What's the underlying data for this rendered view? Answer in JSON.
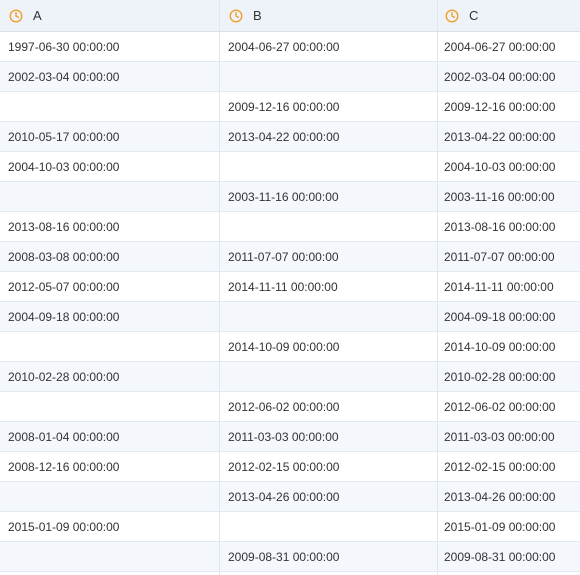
{
  "columns": [
    {
      "label": "A",
      "icon": "clock-icon",
      "icon_color": "#f0a030"
    },
    {
      "label": "B",
      "icon": "clock-icon",
      "icon_color": "#f0a030"
    },
    {
      "label": "C",
      "icon": "clock-icon",
      "icon_color": "#f0a030"
    }
  ],
  "rows": [
    [
      "1997-06-30 00:00:00",
      "2004-06-27 00:00:00",
      "2004-06-27 00:00:00"
    ],
    [
      "2002-03-04 00:00:00",
      "",
      "2002-03-04 00:00:00"
    ],
    [
      "",
      "2009-12-16 00:00:00",
      "2009-12-16 00:00:00"
    ],
    [
      "2010-05-17 00:00:00",
      "2013-04-22 00:00:00",
      "2013-04-22 00:00:00"
    ],
    [
      "2004-10-03 00:00:00",
      "",
      "2004-10-03 00:00:00"
    ],
    [
      "",
      "2003-11-16 00:00:00",
      "2003-11-16 00:00:00"
    ],
    [
      "2013-08-16 00:00:00",
      "",
      "2013-08-16 00:00:00"
    ],
    [
      "2008-03-08 00:00:00",
      "2011-07-07 00:00:00",
      "2011-07-07 00:00:00"
    ],
    [
      "2012-05-07 00:00:00",
      "2014-11-11 00:00:00",
      "2014-11-11 00:00:00"
    ],
    [
      "2004-09-18 00:00:00",
      "",
      "2004-09-18 00:00:00"
    ],
    [
      "",
      "2014-10-09 00:00:00",
      "2014-10-09 00:00:00"
    ],
    [
      "2010-02-28 00:00:00",
      "",
      "2010-02-28 00:00:00"
    ],
    [
      "",
      "2012-06-02 00:00:00",
      "2012-06-02 00:00:00"
    ],
    [
      "2008-01-04 00:00:00",
      "2011-03-03 00:00:00",
      "2011-03-03 00:00:00"
    ],
    [
      "2008-12-16 00:00:00",
      "2012-02-15 00:00:00",
      "2012-02-15 00:00:00"
    ],
    [
      "",
      "2013-04-26 00:00:00",
      "2013-04-26 00:00:00"
    ],
    [
      "2015-01-09 00:00:00",
      "",
      "2015-01-09 00:00:00"
    ],
    [
      "",
      "2009-08-31 00:00:00",
      "2009-08-31 00:00:00"
    ],
    [
      "",
      "",
      ""
    ]
  ],
  "colors": {
    "header_bg": "#eef3fa",
    "row_alt_bg": "#f4f7fc",
    "grid_line": "#dfe6ef",
    "icon_accent": "#f0a030"
  }
}
